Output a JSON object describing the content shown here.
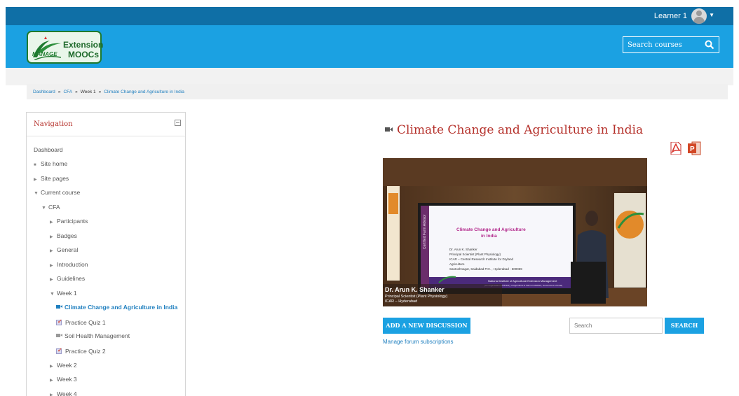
{
  "user": {
    "name": "Learner 1",
    "avatar_icon": "user-avatar-icon",
    "caret_icon": "caret-down-icon"
  },
  "header": {
    "logo_text_line1": "Extension",
    "logo_text_line2": "MOOCs",
    "logo_wordmark": "MANAGE",
    "search_placeholder": "Search courses",
    "search_icon": "search-icon",
    "colors": {
      "userbar": "#0f6fa6",
      "header": "#1ba1e2",
      "accent_title": "#b5312b",
      "link": "#1f7fbf"
    }
  },
  "breadcrumb": {
    "items": [
      "Dashboard",
      "CFA",
      "Week 1",
      "Climate Change and Agriculture in India"
    ],
    "separator": "»"
  },
  "navigation": {
    "title": "Navigation",
    "dock_icon": "dock-block-icon",
    "items": [
      {
        "label": "Dashboard"
      },
      {
        "label": "Site home",
        "marker": "■"
      },
      {
        "label": "Site pages",
        "marker": "▶"
      },
      {
        "label": "Current course",
        "marker": "▼"
      },
      {
        "label": "CFA",
        "marker": "▼"
      },
      {
        "label": "Participants",
        "marker": "▶"
      },
      {
        "label": "Badges",
        "marker": "▶"
      },
      {
        "label": "General",
        "marker": "▶"
      },
      {
        "label": "Introduction",
        "marker": "▶"
      },
      {
        "label": "Guidelines",
        "marker": "▶"
      },
      {
        "label": "Week 1",
        "marker": "▼"
      },
      {
        "label": "Climate Change and Agriculture in India",
        "icon": "video-icon",
        "active": true
      },
      {
        "label": "Practice Quiz 1",
        "icon": "quiz-icon"
      },
      {
        "label": "Soil Health Management",
        "icon": "video-icon"
      },
      {
        "label": "Practice Quiz 2",
        "icon": "quiz-icon"
      },
      {
        "label": "Week 2",
        "marker": "▶"
      },
      {
        "label": "Week 3",
        "marker": "▶"
      },
      {
        "label": "Week 4",
        "marker": "▶"
      }
    ]
  },
  "main": {
    "title": "Climate Change and Agriculture in India",
    "title_icon": "video-icon",
    "resource_icons": [
      "pdf-icon",
      "powerpoint-icon"
    ],
    "video": {
      "slide_title_line1": "Climate Change and Agriculture",
      "slide_title_line2": "in India",
      "slide_body": [
        "Dr. Arun K. Shanker",
        "Principal Scientist (Plant Physiology)",
        "ICAR – Central Research Institute for Dryland",
        "Agriculture",
        "Santoshnagar, Saidabad P.O. , Hyderabad - 500059"
      ],
      "slide_footer_line1": "National Institute of Agricultural Extension Management",
      "slide_footer_line2": "(An Organisation of Ministry of Agriculture & Farmers Welfare, Government of India)",
      "slide_side": "Certified Farm Advisor",
      "lower_third_name": "Dr. Arun K. Shanker",
      "lower_third_line2": "Principal Scientist (Plant Physiology)",
      "lower_third_line3": "ICAR – Hyderabad"
    },
    "add_discussion_label": "ADD A NEW DISCUSSION",
    "forum_search_placeholder": "Search",
    "search_button_label": "SEARCH",
    "manage_link": "Manage forum subscriptions"
  }
}
